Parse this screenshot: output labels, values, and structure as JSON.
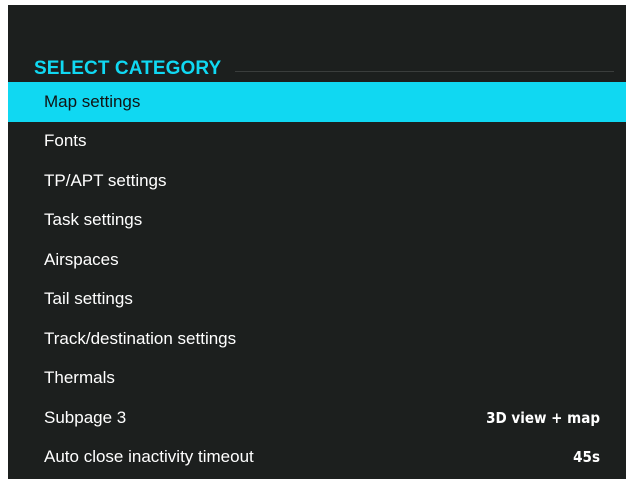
{
  "header": {
    "title": "SELECT CATEGORY"
  },
  "menu": {
    "items": [
      {
        "label": "Map settings",
        "value": ""
      },
      {
        "label": "Fonts",
        "value": ""
      },
      {
        "label": "TP/APT settings",
        "value": ""
      },
      {
        "label": "Task settings",
        "value": ""
      },
      {
        "label": "Airspaces",
        "value": ""
      },
      {
        "label": "Tail settings",
        "value": ""
      },
      {
        "label": "Track/destination settings",
        "value": ""
      },
      {
        "label": "Thermals",
        "value": ""
      },
      {
        "label": "Subpage 3",
        "value": "3D view + map"
      },
      {
        "label": "Auto close inactivity timeout",
        "value": "45s"
      }
    ],
    "selected_index": 0
  },
  "colors": {
    "background": "#1c1f1e",
    "accent": "#10d8f2",
    "text": "#ffffff"
  }
}
